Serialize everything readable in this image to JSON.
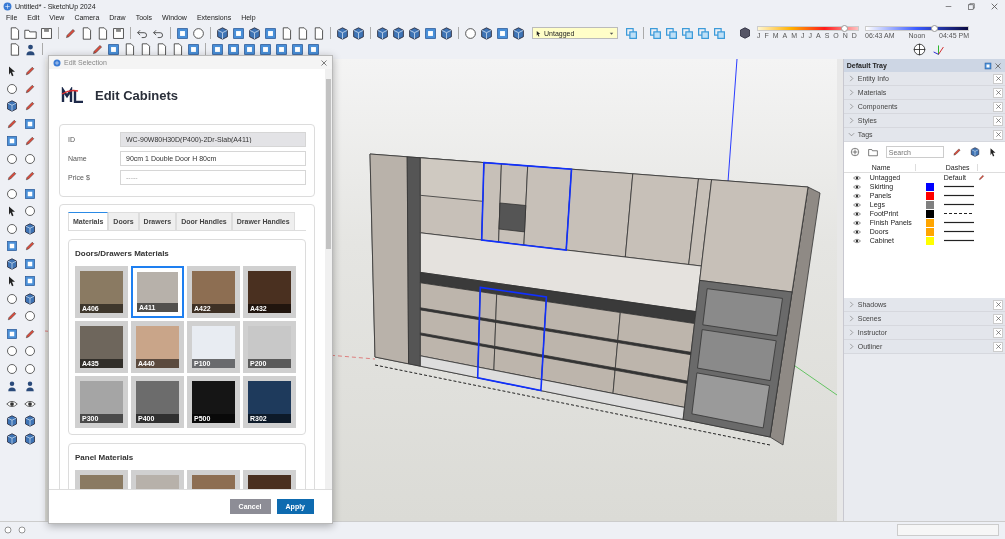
{
  "app": {
    "title": "Untitled* - SketchUp 2024"
  },
  "menu": [
    "File",
    "Edit",
    "View",
    "Camera",
    "Draw",
    "Tools",
    "Window",
    "Extensions",
    "Help"
  ],
  "tag_dropdown": {
    "value": "Untagged"
  },
  "shadows": {
    "months": [
      "J",
      "F",
      "M",
      "A",
      "M",
      "J",
      "J",
      "A",
      "S",
      "O",
      "N",
      "D"
    ],
    "month_slider": {
      "level": 0.86
    },
    "times": [
      "06:43 AM",
      "Noon",
      "04:45 PM"
    ],
    "time_slider": {
      "level": 0.67
    }
  },
  "dialog": {
    "title": "Edit Selection",
    "heading": "Edit Cabinets",
    "fields": [
      {
        "label": "ID",
        "value": "WC-90W80H30D(P400)-2Dr-Slab(A411)",
        "disabled": true
      },
      {
        "label": "Name",
        "value": "90cm 1 Double Door H 80cm",
        "disabled": false
      },
      {
        "label": "Price $",
        "placeholder": "-----",
        "disabled": false
      }
    ],
    "tabs": [
      {
        "label": "Materials",
        "selected": true
      },
      {
        "label": "Doors",
        "selected": false
      },
      {
        "label": "Drawers",
        "selected": false
      },
      {
        "label": "Door Handles",
        "selected": false
      },
      {
        "label": "Drawer Handles",
        "selected": false
      }
    ],
    "sections": [
      {
        "title": "Doors/Drawers Materials",
        "swatches": [
          {
            "label": "A406",
            "color": "#8a7a62",
            "selected": false
          },
          {
            "label": "A411",
            "color": "#b7b1aa",
            "selected": true
          },
          {
            "label": "A422",
            "color": "#8d6e52",
            "selected": false
          },
          {
            "label": "A432",
            "color": "#4a3020",
            "selected": false
          },
          {
            "label": "A435",
            "color": "#6e665c",
            "selected": false
          },
          {
            "label": "A440",
            "color": "#c9a589",
            "selected": false
          },
          {
            "label": "P100",
            "color": "#e8ecf2",
            "selected": false
          },
          {
            "label": "P200",
            "color": "#c8c8c8",
            "selected": false
          },
          {
            "label": "P300",
            "color": "#a5a5a5",
            "selected": false
          },
          {
            "label": "P400",
            "color": "#6c6c6c",
            "selected": false
          },
          {
            "label": "P500",
            "color": "#151515",
            "selected": false
          },
          {
            "label": "R302",
            "color": "#1e3a5c",
            "selected": false
          }
        ]
      },
      {
        "title": "Panel Materials",
        "swatches": [
          {
            "color": "#8a7a62",
            "selected": false
          },
          {
            "color": "#b7b1aa",
            "selected": false
          },
          {
            "color": "#8d6e52",
            "selected": false
          },
          {
            "color": "#4a3020",
            "selected": false
          }
        ]
      }
    ],
    "buttons": [
      {
        "label": "Cancel",
        "kind": "secondary"
      },
      {
        "label": "Apply",
        "kind": "primary"
      }
    ]
  },
  "tray": {
    "title": "Default Tray",
    "panels_top": [
      {
        "label": "Entity Info",
        "expanded": false
      },
      {
        "label": "Materials",
        "expanded": false
      },
      {
        "label": "Components",
        "expanded": false
      },
      {
        "label": "Styles",
        "expanded": false
      },
      {
        "label": "Tags",
        "expanded": true
      }
    ],
    "tags": {
      "search": {
        "placeholder": "Search"
      },
      "columns": [
        "Name",
        "Dashes"
      ],
      "rows": [
        {
          "name": "Untagged",
          "kind": "default",
          "dashes": "Default"
        },
        {
          "name": "Skirting",
          "kind": "solid",
          "color": "#0000ff"
        },
        {
          "name": "Panels",
          "kind": "solid",
          "color": "#ff0000"
        },
        {
          "name": "Legs",
          "kind": "solid",
          "color": "#808080"
        },
        {
          "name": "FootPrint",
          "kind": "dashed",
          "color": "#000000"
        },
        {
          "name": "Finish Panels",
          "kind": "solid",
          "color": "#ffa500"
        },
        {
          "name": "Doors",
          "kind": "solid",
          "color": "#ffa500"
        },
        {
          "name": "Cabinet",
          "kind": "solid",
          "color": "#ffff00"
        }
      ]
    },
    "panels_bottom": [
      {
        "label": "Shadows",
        "expanded": false
      },
      {
        "label": "Scenes",
        "expanded": false
      },
      {
        "label": "Instructor",
        "expanded": false
      },
      {
        "label": "Outliner",
        "expanded": false
      }
    ]
  }
}
